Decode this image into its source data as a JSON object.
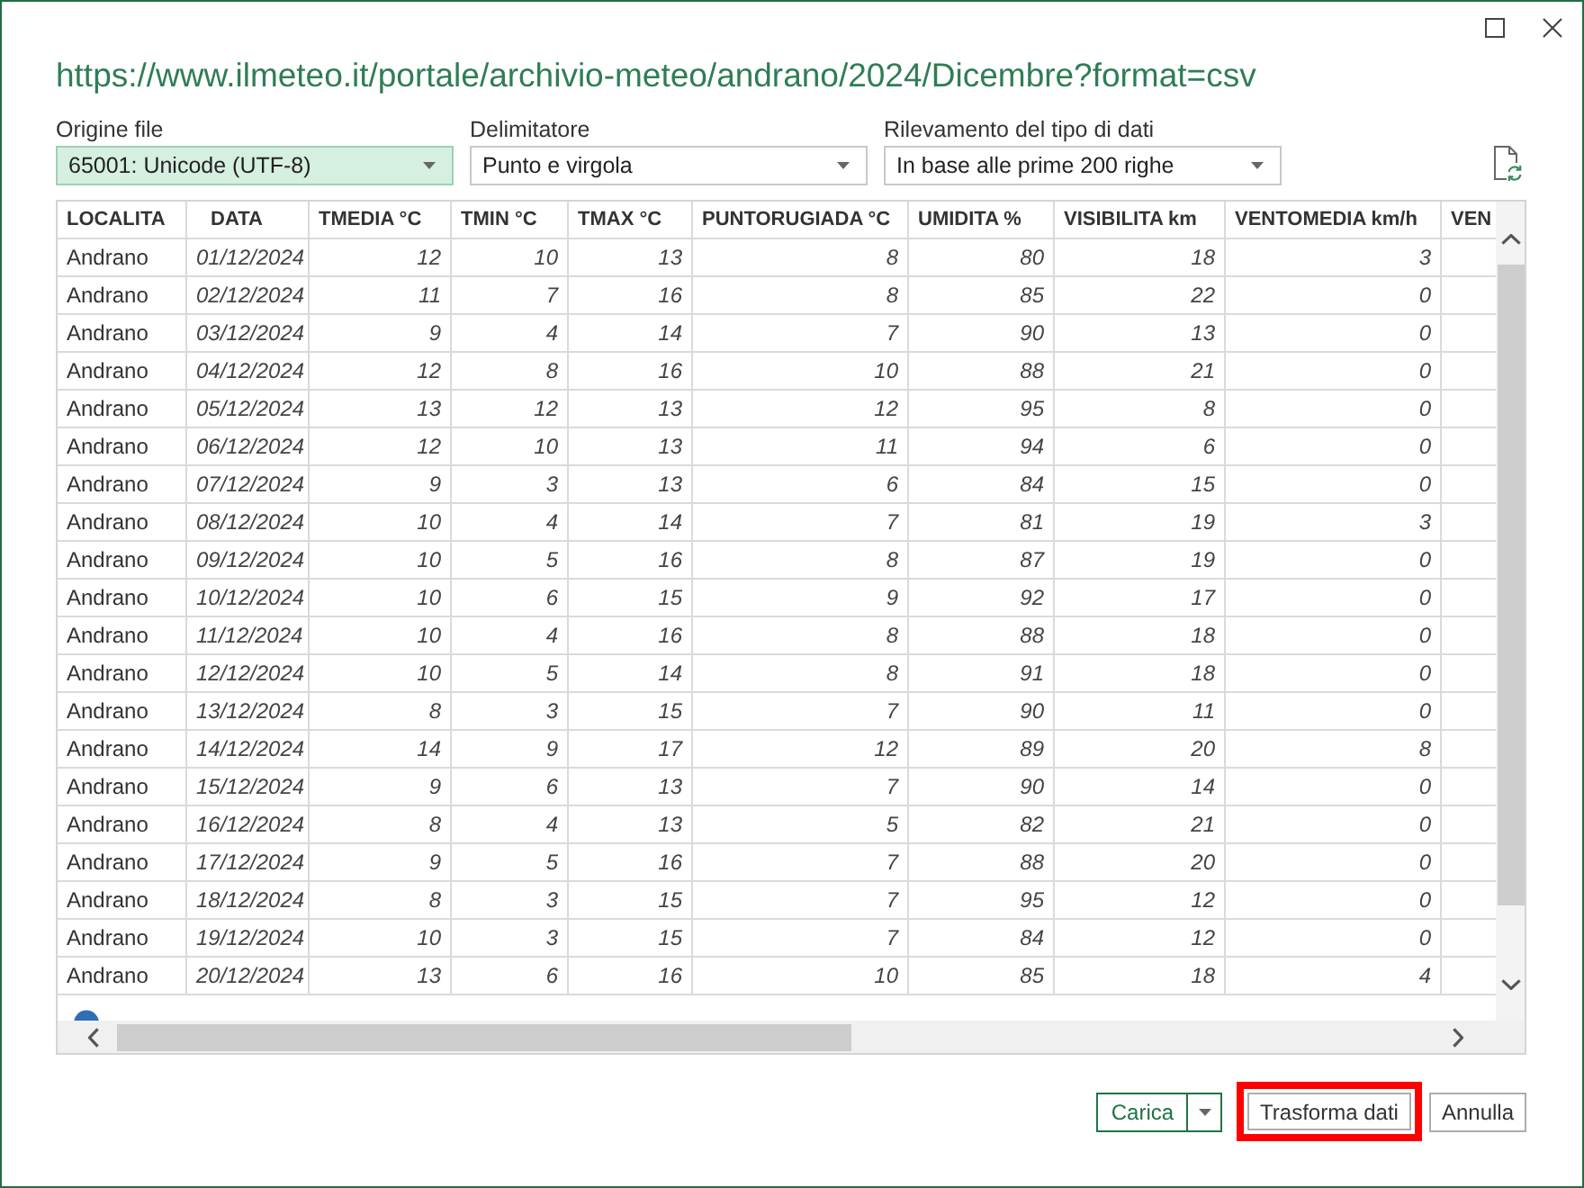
{
  "source_url": "https://www.ilmeteo.it/portale/archivio-meteo/andrano/2024/Dicembre?format=csv",
  "options": [
    {
      "label": "Origine file",
      "value": "65001: Unicode (UTF-8)",
      "focused": true
    },
    {
      "label": "Delimitatore",
      "value": "Punto e virgola",
      "focused": false
    },
    {
      "label": "Rilevamento del tipo di dati",
      "value": "In base alle prime 200 righe",
      "focused": false
    }
  ],
  "table": {
    "columns": [
      {
        "label": "LOCALITA",
        "kind": "text"
      },
      {
        "label": "DATA",
        "kind": "date"
      },
      {
        "label": "TMEDIA °C",
        "kind": "number"
      },
      {
        "label": "TMIN °C",
        "kind": "number"
      },
      {
        "label": "TMAX °C",
        "kind": "number"
      },
      {
        "label": "PUNTORUGIADA °C",
        "kind": "number"
      },
      {
        "label": "UMIDITA %",
        "kind": "number"
      },
      {
        "label": "VISIBILITA km",
        "kind": "number"
      },
      {
        "label": "VENTOMEDIA km/h",
        "kind": "number"
      },
      {
        "label": "VEN",
        "kind": "number"
      }
    ],
    "rows": [
      [
        "Andrano",
        "01/12/2024",
        "12",
        "10",
        "13",
        "8",
        "80",
        "18",
        "3"
      ],
      [
        "Andrano",
        "02/12/2024",
        "11",
        "7",
        "16",
        "8",
        "85",
        "22",
        "0"
      ],
      [
        "Andrano",
        "03/12/2024",
        "9",
        "4",
        "14",
        "7",
        "90",
        "13",
        "0"
      ],
      [
        "Andrano",
        "04/12/2024",
        "12",
        "8",
        "16",
        "10",
        "88",
        "21",
        "0"
      ],
      [
        "Andrano",
        "05/12/2024",
        "13",
        "12",
        "13",
        "12",
        "95",
        "8",
        "0"
      ],
      [
        "Andrano",
        "06/12/2024",
        "12",
        "10",
        "13",
        "11",
        "94",
        "6",
        "0"
      ],
      [
        "Andrano",
        "07/12/2024",
        "9",
        "3",
        "13",
        "6",
        "84",
        "15",
        "0"
      ],
      [
        "Andrano",
        "08/12/2024",
        "10",
        "4",
        "14",
        "7",
        "81",
        "19",
        "3"
      ],
      [
        "Andrano",
        "09/12/2024",
        "10",
        "5",
        "16",
        "8",
        "87",
        "19",
        "0"
      ],
      [
        "Andrano",
        "10/12/2024",
        "10",
        "6",
        "15",
        "9",
        "92",
        "17",
        "0"
      ],
      [
        "Andrano",
        "11/12/2024",
        "10",
        "4",
        "16",
        "8",
        "88",
        "18",
        "0"
      ],
      [
        "Andrano",
        "12/12/2024",
        "10",
        "5",
        "14",
        "8",
        "91",
        "18",
        "0"
      ],
      [
        "Andrano",
        "13/12/2024",
        "8",
        "3",
        "15",
        "7",
        "90",
        "11",
        "0"
      ],
      [
        "Andrano",
        "14/12/2024",
        "14",
        "9",
        "17",
        "12",
        "89",
        "20",
        "8"
      ],
      [
        "Andrano",
        "15/12/2024",
        "9",
        "6",
        "13",
        "7",
        "90",
        "14",
        "0"
      ],
      [
        "Andrano",
        "16/12/2024",
        "8",
        "4",
        "13",
        "5",
        "82",
        "21",
        "0"
      ],
      [
        "Andrano",
        "17/12/2024",
        "9",
        "5",
        "16",
        "7",
        "88",
        "20",
        "0"
      ],
      [
        "Andrano",
        "18/12/2024",
        "8",
        "3",
        "15",
        "7",
        "95",
        "12",
        "0"
      ],
      [
        "Andrano",
        "19/12/2024",
        "10",
        "3",
        "15",
        "7",
        "84",
        "12",
        "0"
      ],
      [
        "Andrano",
        "20/12/2024",
        "13",
        "6",
        "16",
        "10",
        "85",
        "18",
        "4"
      ]
    ]
  },
  "buttons": [
    {
      "label": "Carica",
      "kind": "split",
      "highlighted": false
    },
    {
      "label": "Trasforma dati",
      "kind": "plain",
      "highlighted": true
    },
    {
      "label": "Annulla",
      "kind": "plain",
      "highlighted": false
    }
  ]
}
